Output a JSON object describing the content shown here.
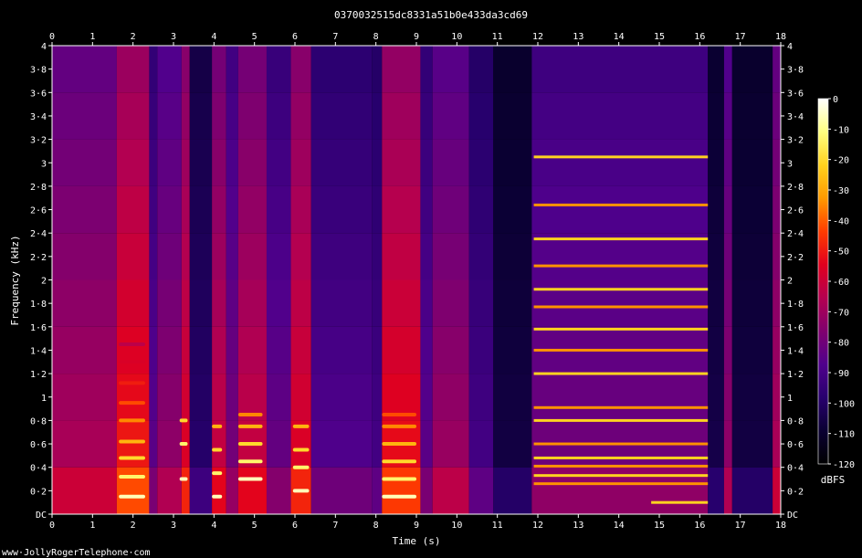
{
  "chart_data": {
    "type": "heatmap",
    "title": "0370032515dc8331a51b0e433da3cd69",
    "xlabel": "Time (s)",
    "ylabel": "Frequency (kHz)",
    "xlim": [
      0,
      18
    ],
    "ylim": [
      0,
      4
    ],
    "x_ticks": [
      "0",
      "1",
      "2",
      "3",
      "4",
      "5",
      "6",
      "7",
      "8",
      "9",
      "10",
      "11",
      "12",
      "13",
      "14",
      "15",
      "16",
      "17",
      "18"
    ],
    "y_ticks": [
      "DC",
      "0·2",
      "0·4",
      "0·6",
      "0·8",
      "1",
      "1·2",
      "1·4",
      "1·6",
      "1·8",
      "2",
      "2·2",
      "2·4",
      "2·6",
      "2·8",
      "3",
      "3·2",
      "3·4",
      "3·6",
      "3·8",
      "4"
    ],
    "colorbar": {
      "label": "dBFS",
      "range": [
        -120,
        0
      ],
      "ticks": [
        "0",
        "-10",
        "-20",
        "-30",
        "-40",
        "-50",
        "-60",
        "-70",
        "-80",
        "-90",
        "-100",
        "-110",
        "-120"
      ],
      "colors": [
        "#ffffff",
        "#ffff80",
        "#ffd21e",
        "#ff9a00",
        "#ff3c00",
        "#e1001e",
        "#b40050",
        "#80006e",
        "#50008c",
        "#28006e",
        "#0a0032",
        "#000000"
      ]
    },
    "regions": [
      {
        "t": [
          0.0,
          1.6
        ],
        "level": 0.45
      },
      {
        "t": [
          1.6,
          2.4
        ],
        "level": 0.6
      },
      {
        "t": [
          2.4,
          2.6
        ],
        "level": 0.3
      },
      {
        "t": [
          2.6,
          3.2
        ],
        "level": 0.4
      },
      {
        "t": [
          3.2,
          3.4
        ],
        "level": 0.55
      },
      {
        "t": [
          3.4,
          3.95
        ],
        "level": 0.18
      },
      {
        "t": [
          3.95,
          4.3
        ],
        "level": 0.5
      },
      {
        "t": [
          4.3,
          4.6
        ],
        "level": 0.35
      },
      {
        "t": [
          4.6,
          5.3
        ],
        "level": 0.5
      },
      {
        "t": [
          5.3,
          5.9
        ],
        "level": 0.32
      },
      {
        "t": [
          5.9,
          6.4
        ],
        "level": 0.55
      },
      {
        "t": [
          6.4,
          7.9
        ],
        "level": 0.28
      },
      {
        "t": [
          7.9,
          8.15
        ],
        "level": 0.25
      },
      {
        "t": [
          8.15,
          9.1
        ],
        "level": 0.58
      },
      {
        "t": [
          9.1,
          9.4
        ],
        "level": 0.3
      },
      {
        "t": [
          9.4,
          10.3
        ],
        "level": 0.42
      },
      {
        "t": [
          10.3,
          10.9
        ],
        "level": 0.25
      },
      {
        "t": [
          10.9,
          11.85
        ],
        "level": 0.12
      },
      {
        "t": [
          11.85,
          16.2
        ],
        "level": 0.34
      },
      {
        "t": [
          16.2,
          16.6
        ],
        "level": 0.13
      },
      {
        "t": [
          16.6,
          16.8
        ],
        "level": 0.4
      },
      {
        "t": [
          16.8,
          17.8
        ],
        "level": 0.12
      },
      {
        "t": [
          17.8,
          18.0
        ],
        "level": 0.45
      }
    ],
    "tones": [
      {
        "t": [
          11.9,
          16.2
        ],
        "f_khz": [
          3.05,
          2.64,
          2.35,
          2.12,
          1.92,
          1.77,
          1.58,
          1.4,
          1.2,
          0.91,
          0.8,
          0.6,
          0.48,
          0.41,
          0.33,
          0.26
        ]
      },
      {
        "t": [
          14.8,
          16.2
        ],
        "f_khz": [
          0.1
        ]
      }
    ],
    "formant_bursts": [
      {
        "t": [
          1.65,
          2.3
        ],
        "f_khz": [
          0.15,
          0.32,
          0.48,
          0.62,
          0.8,
          0.95,
          1.12,
          1.3,
          1.45
        ]
      },
      {
        "t": [
          3.15,
          3.35
        ],
        "f_khz": [
          0.3,
          0.6,
          0.8
        ]
      },
      {
        "t": [
          3.95,
          4.2
        ],
        "f_khz": [
          0.15,
          0.35,
          0.55,
          0.75
        ]
      },
      {
        "t": [
          4.6,
          5.2
        ],
        "f_khz": [
          0.3,
          0.45,
          0.6,
          0.75,
          0.85
        ]
      },
      {
        "t": [
          5.95,
          6.35
        ],
        "f_khz": [
          0.2,
          0.4,
          0.55,
          0.75
        ]
      },
      {
        "t": [
          8.15,
          9.0
        ],
        "f_khz": [
          0.15,
          0.3,
          0.45,
          0.6,
          0.75,
          0.85
        ]
      }
    ]
  },
  "footer": {
    "credit": "www·JollyRogerTelephone·com"
  }
}
